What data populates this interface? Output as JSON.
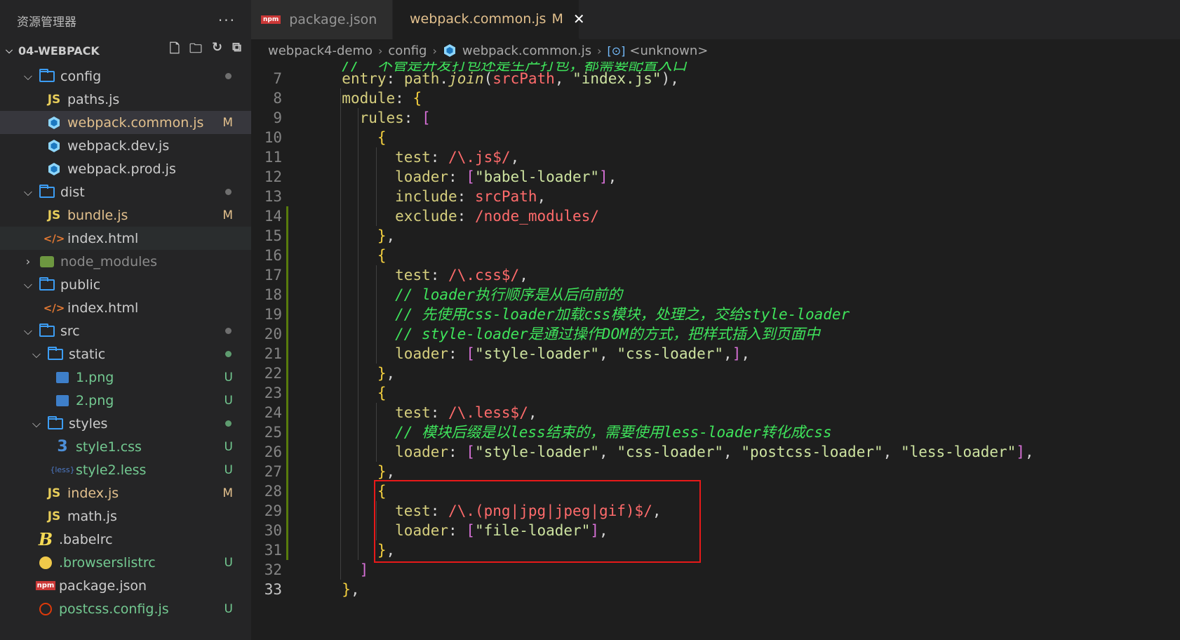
{
  "sidebar": {
    "title": "资源管理器",
    "more": "···",
    "project": "04-WEBPACK",
    "items": [
      {
        "label": "config",
        "badge": ""
      },
      {
        "label": "paths.js",
        "badge": ""
      },
      {
        "label": "webpack.common.js",
        "badge": "M"
      },
      {
        "label": "webpack.dev.js",
        "badge": ""
      },
      {
        "label": "webpack.prod.js",
        "badge": ""
      },
      {
        "label": "dist",
        "badge": ""
      },
      {
        "label": "bundle.js",
        "badge": "M"
      },
      {
        "label": "index.html",
        "badge": ""
      },
      {
        "label": "node_modules",
        "badge": ""
      },
      {
        "label": "public",
        "badge": ""
      },
      {
        "label": "index.html",
        "badge": ""
      },
      {
        "label": "src",
        "badge": ""
      },
      {
        "label": "static",
        "badge": ""
      },
      {
        "label": "1.png",
        "badge": "U"
      },
      {
        "label": "2.png",
        "badge": "U"
      },
      {
        "label": "styles",
        "badge": ""
      },
      {
        "label": "style1.css",
        "badge": "U"
      },
      {
        "label": "style2.less",
        "badge": "U"
      },
      {
        "label": "index.js",
        "badge": "M"
      },
      {
        "label": "math.js",
        "badge": ""
      },
      {
        "label": ".babelrc",
        "badge": ""
      },
      {
        "label": ".browserslistrc",
        "badge": "U"
      },
      {
        "label": "package.json",
        "badge": ""
      },
      {
        "label": "postcss.config.js",
        "badge": "U"
      }
    ]
  },
  "tabs": [
    {
      "label": "package.json",
      "icon": "npm-icon"
    },
    {
      "label": "webpack.common.js",
      "modified": "M",
      "close": "✕",
      "icon": "webpack-cube-icon"
    }
  ],
  "breadcrumb": {
    "parts": [
      "webpack4-demo",
      "config",
      "webpack.common.js",
      "<unknown>"
    ]
  },
  "editor": {
    "line_numbers": [
      "7",
      "8",
      "9",
      "10",
      "11",
      "12",
      "13",
      "14",
      "15",
      "16",
      "17",
      "18",
      "19",
      "20",
      "21",
      "22",
      "23",
      "24",
      "25",
      "26",
      "27",
      "28",
      "29",
      "30",
      "31",
      "32",
      "33"
    ],
    "partial_top_line": "  //  不管是开发打包还是生产打包，都需要配置入口",
    "lines": [
      "  entry: path.join(srcPath, \"index.js\"),",
      "  module: {",
      "    rules: [",
      "      {",
      "        test: /\\.js$/,",
      "        loader: [\"babel-loader\"],",
      "        include: srcPath,",
      "        exclude: /node_modules/",
      "      },",
      "      {",
      "        test: /\\.css$/,",
      "        // loader执行顺序是从后向前的",
      "        // 先使用css-loader加载css模块，处理之，交给style-loader",
      "        // style-loader是通过操作DOM的方式，把样式插入到页面中",
      "        loader: [\"style-loader\", \"css-loader\",],",
      "      },",
      "      {",
      "        test: /\\.less$/,",
      "        // 模块后缀是以less结束的，需要使用less-loader转化成css",
      "        loader: [\"style-loader\", \"css-loader\", \"postcss-loader\", \"less-loader\"],",
      "      },",
      "      {",
      "        test: /\\.(png|jpg|jpeg|gif)$/,",
      "        loader: [\"file-loader\"],",
      "      },",
      "    ]",
      "  },"
    ]
  },
  "colors": {
    "sidebar_bg": "#252526",
    "editor_bg": "#1e1e1e",
    "modified": "#e2c08d",
    "untracked": "#73c991",
    "highlight_box": "#e81919"
  }
}
